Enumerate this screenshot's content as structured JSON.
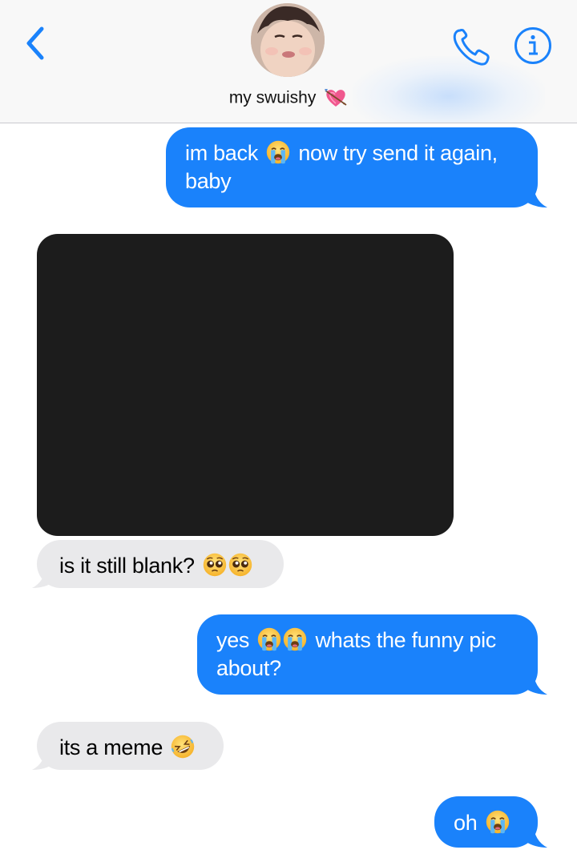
{
  "header": {
    "contact_name": "my swuishy",
    "back_icon": "chevron-left-icon",
    "call_icon": "phone-icon",
    "info_icon": "info-icon",
    "name_suffix_icon": "heart-with-arrow-icon",
    "accent_color": "#1a82fb"
  },
  "messages": [
    {
      "direction": "sent",
      "type": "text",
      "parts": [
        "im back",
        "",
        "now try send it again,",
        "baby"
      ],
      "emoji": [
        "loudly-crying-face"
      ]
    },
    {
      "direction": "received",
      "type": "image"
    },
    {
      "direction": "received",
      "type": "text",
      "parts": [
        "is it still blank?"
      ],
      "emoji": [
        "pleading-face",
        "pleading-face"
      ]
    },
    {
      "direction": "sent",
      "type": "text",
      "parts": [
        "yes",
        "whats the funny pic",
        "about?"
      ],
      "emoji": [
        "loudly-crying-face",
        "loudly-crying-face"
      ]
    },
    {
      "direction": "received",
      "type": "text",
      "parts": [
        "its a meme"
      ],
      "emoji": [
        "rolling-on-the-floor-laughing"
      ]
    },
    {
      "direction": "sent",
      "type": "text",
      "parts": [
        "oh"
      ],
      "emoji": [
        "loudly-crying-face"
      ]
    }
  ],
  "colors": {
    "sent_bubble": "#1a82fb",
    "received_bubble": "#e9e9eb",
    "image_placeholder": "#1c1c1c"
  }
}
